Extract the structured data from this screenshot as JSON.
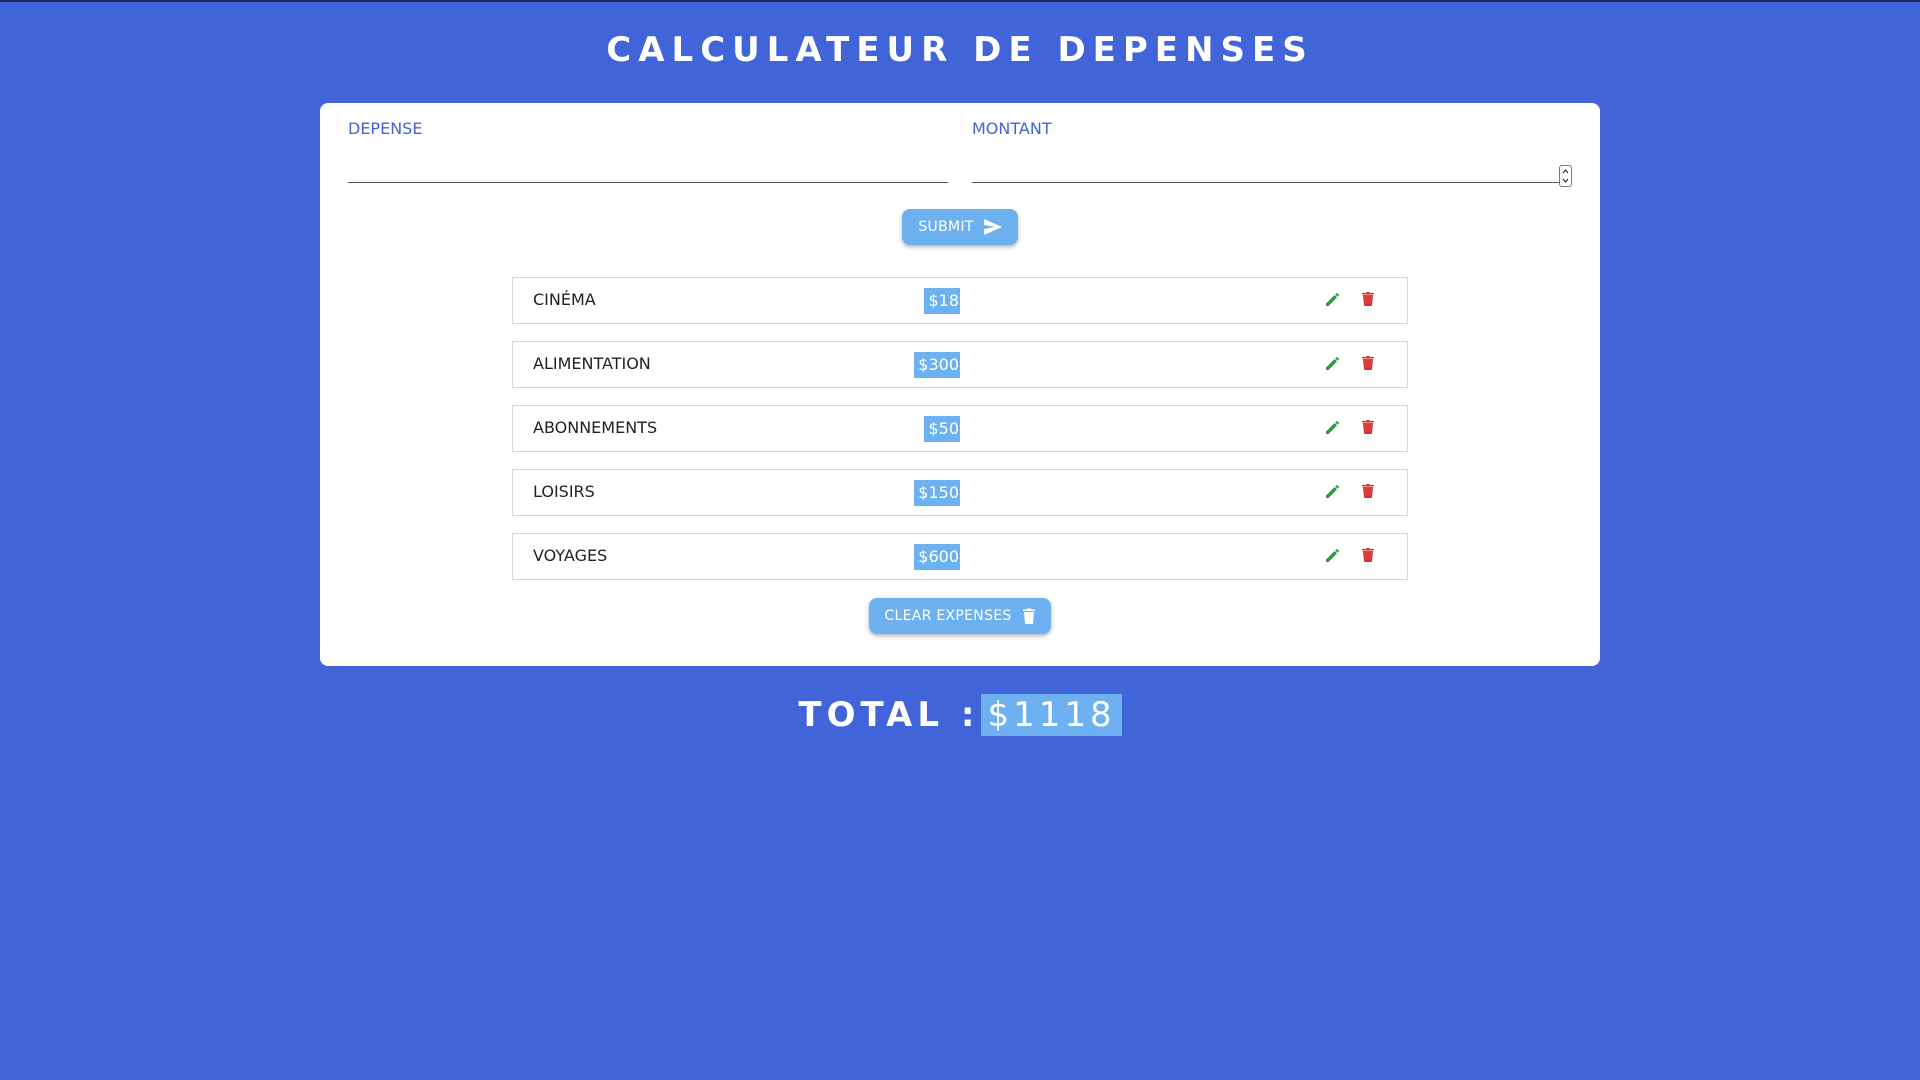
{
  "app": {
    "title": "CALCULATEUR DE DEPENSES"
  },
  "form": {
    "depense_label": "DEPENSE",
    "depense_value": "",
    "montant_label": "MONTANT",
    "montant_value": "",
    "submit_label": "SUBMIT",
    "submit_icon": "send-icon"
  },
  "expenses": [
    {
      "name": "CINÉMA",
      "amount": "$18"
    },
    {
      "name": "ALIMENTATION",
      "amount": "$300"
    },
    {
      "name": "ABONNEMENTS",
      "amount": "$50"
    },
    {
      "name": "LOISIRS",
      "amount": "$150"
    },
    {
      "name": "VOYAGES",
      "amount": "$600"
    }
  ],
  "actions": {
    "edit_icon": "pencil-icon",
    "delete_icon": "trash-icon",
    "clear_label": "CLEAR EXPENSES",
    "clear_icon": "trash-icon"
  },
  "total": {
    "label": "TOTAL :",
    "value": "$1118"
  },
  "colors": {
    "background": "#4164d9",
    "accent": "#6eb1f0",
    "edit": "#2e9e3b",
    "delete": "#d63a3a"
  }
}
